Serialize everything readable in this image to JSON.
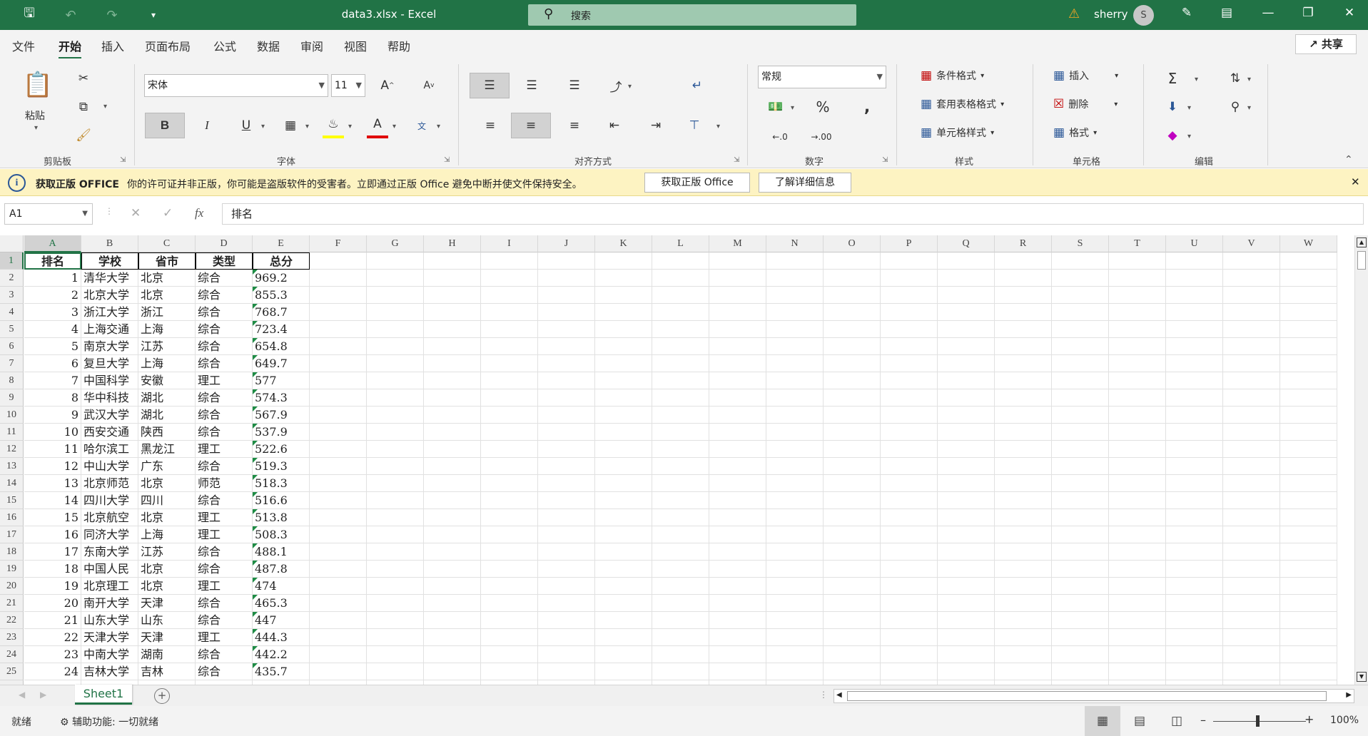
{
  "titlebar": {
    "doc_title": "data3.xlsx  -  Excel",
    "search_label": "搜索",
    "user_name": "sherry",
    "avatar_initial": "S"
  },
  "menu": {
    "items": [
      "文件",
      "开始",
      "插入",
      "页面布局",
      "公式",
      "数据",
      "审阅",
      "视图",
      "帮助"
    ],
    "active": "开始",
    "share_label": "共享"
  },
  "ribbon": {
    "clipboard": {
      "paste_label": "粘贴",
      "group_label": "剪贴板"
    },
    "font": {
      "font_name": "宋体",
      "font_size": "11",
      "bold_label": "B",
      "italic_label": "I",
      "underline_label": "U",
      "group_label": "字体"
    },
    "alignment": {
      "group_label": "对齐方式"
    },
    "number": {
      "format": "常规",
      "group_label": "数字"
    },
    "styles": {
      "conditional": "条件格式",
      "table": "套用表格格式",
      "cell": "单元格样式",
      "group_label": "样式"
    },
    "cells": {
      "insert": "插入",
      "delete": "删除",
      "format": "格式",
      "group_label": "单元格"
    },
    "editing": {
      "group_label": "编辑"
    }
  },
  "message_bar": {
    "title": "获取正版 OFFICE",
    "text": "你的许可证并非正版，你可能是盗版软件的受害者。立即通过正版 Office 避免中断并使文件保持安全。",
    "button_get": "获取正版 Office",
    "button_learn": "了解详细信息"
  },
  "formula_bar": {
    "name_box": "A1",
    "formula": "排名"
  },
  "sheet": {
    "columns": [
      "A",
      "B",
      "C",
      "D",
      "E",
      "F",
      "G",
      "H",
      "I",
      "J",
      "K",
      "L",
      "M",
      "N",
      "O",
      "P",
      "Q",
      "R",
      "S",
      "T",
      "U",
      "V",
      "W"
    ],
    "header_row": [
      "排名",
      "学校",
      "省市",
      "类型",
      "总分"
    ],
    "rows": [
      [
        "1",
        "清华大学",
        "北京",
        "综合",
        "969.2"
      ],
      [
        "2",
        "北京大学",
        "北京",
        "综合",
        "855.3"
      ],
      [
        "3",
        "浙江大学",
        "浙江",
        "综合",
        "768.7"
      ],
      [
        "4",
        "上海交通",
        "上海",
        "综合",
        "723.4"
      ],
      [
        "5",
        "南京大学",
        "江苏",
        "综合",
        "654.8"
      ],
      [
        "6",
        "复旦大学",
        "上海",
        "综合",
        "649.7"
      ],
      [
        "7",
        "中国科学",
        "安徽",
        "理工",
        "577"
      ],
      [
        "8",
        "华中科技",
        "湖北",
        "综合",
        "574.3"
      ],
      [
        "9",
        "武汉大学",
        "湖北",
        "综合",
        "567.9"
      ],
      [
        "10",
        "西安交通",
        "陕西",
        "综合",
        "537.9"
      ],
      [
        "11",
        "哈尔滨工",
        "黑龙江",
        "理工",
        "522.6"
      ],
      [
        "12",
        "中山大学",
        "广东",
        "综合",
        "519.3"
      ],
      [
        "13",
        "北京师范",
        "北京",
        "师范",
        "518.3"
      ],
      [
        "14",
        "四川大学",
        "四川",
        "综合",
        "516.6"
      ],
      [
        "15",
        "北京航空",
        "北京",
        "理工",
        "513.8"
      ],
      [
        "16",
        "同济大学",
        "上海",
        "理工",
        "508.3"
      ],
      [
        "17",
        "东南大学",
        "江苏",
        "综合",
        "488.1"
      ],
      [
        "18",
        "中国人民",
        "北京",
        "综合",
        "487.8"
      ],
      [
        "19",
        "北京理工",
        "北京",
        "理工",
        "474"
      ],
      [
        "20",
        "南开大学",
        "天津",
        "综合",
        "465.3"
      ],
      [
        "21",
        "山东大学",
        "山东",
        "综合",
        "447"
      ],
      [
        "22",
        "天津大学",
        "天津",
        "理工",
        "444.3"
      ],
      [
        "23",
        "中南大学",
        "湖南",
        "综合",
        "442.2"
      ],
      [
        "24",
        "吉林大学",
        "吉林",
        "综合",
        "435.7"
      ]
    ],
    "tab_name": "Sheet1"
  },
  "status": {
    "ready": "就绪",
    "accessibility": "辅助功能: 一切就绪",
    "zoom": "100%"
  }
}
